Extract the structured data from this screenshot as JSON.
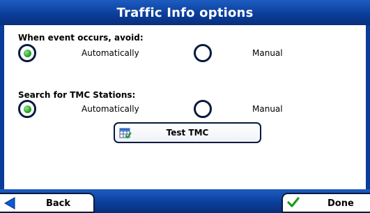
{
  "title": "Traffic Info options",
  "sections": [
    {
      "label": "When event occurs, avoid:",
      "options": [
        {
          "label": "Automatically",
          "selected": true
        },
        {
          "label": "Manual",
          "selected": false
        }
      ]
    },
    {
      "label": "Search for TMC Stations:",
      "options": [
        {
          "label": "Automatically",
          "selected": true
        },
        {
          "label": "Manual",
          "selected": false
        }
      ]
    }
  ],
  "test_button": {
    "label": "Test TMC",
    "icon": "test-tmc-icon"
  },
  "footer": {
    "back_label": "Back",
    "done_label": "Done",
    "back_icon": "back-arrow-icon",
    "done_icon": "checkmark-icon"
  },
  "colors": {
    "bar_blue": "#0b3f9c",
    "radio_selected_green": "#1a9a1a",
    "outline_dark": "#061a3d"
  }
}
